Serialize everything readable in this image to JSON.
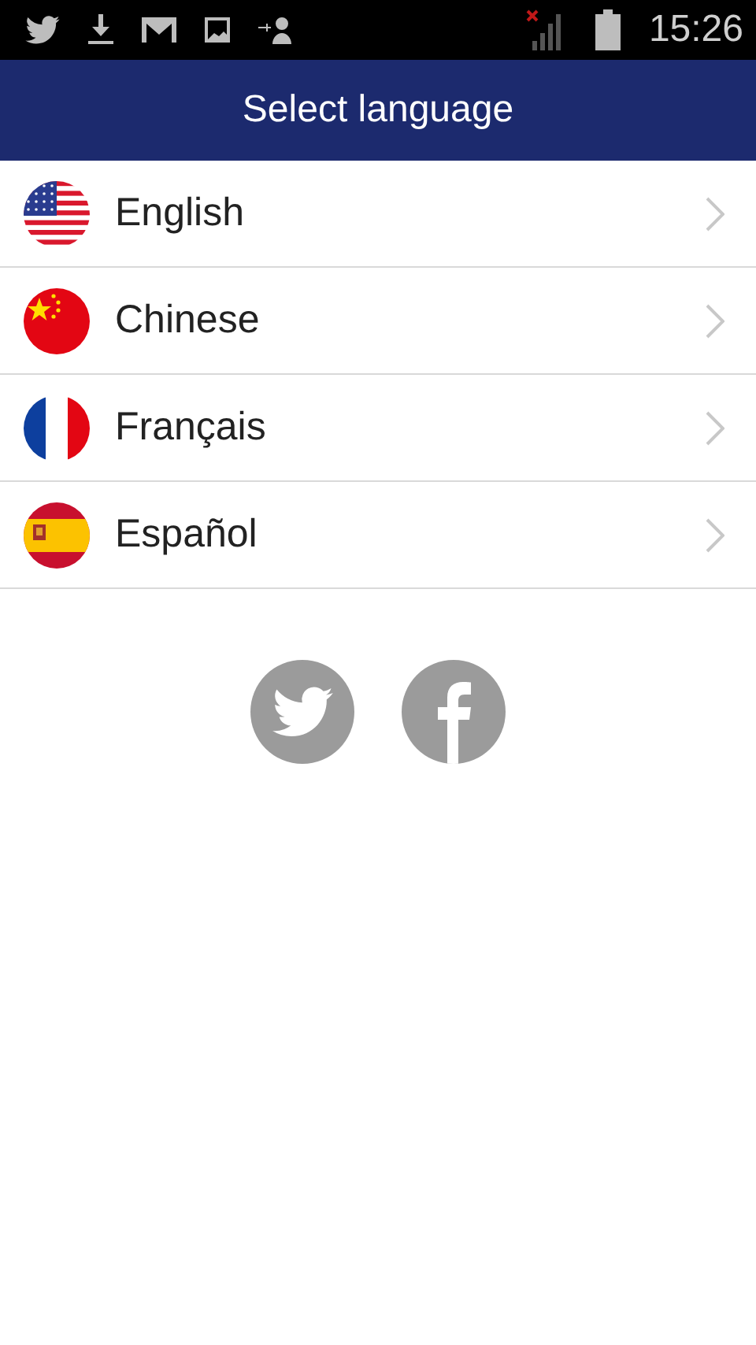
{
  "status_bar": {
    "time": "15:26"
  },
  "header": {
    "title": "Select language"
  },
  "languages": [
    {
      "label": "English",
      "kind": "us"
    },
    {
      "label": "Chinese",
      "kind": "cn"
    },
    {
      "label": "Français",
      "kind": "fr"
    },
    {
      "label": "Español",
      "kind": "es"
    }
  ]
}
